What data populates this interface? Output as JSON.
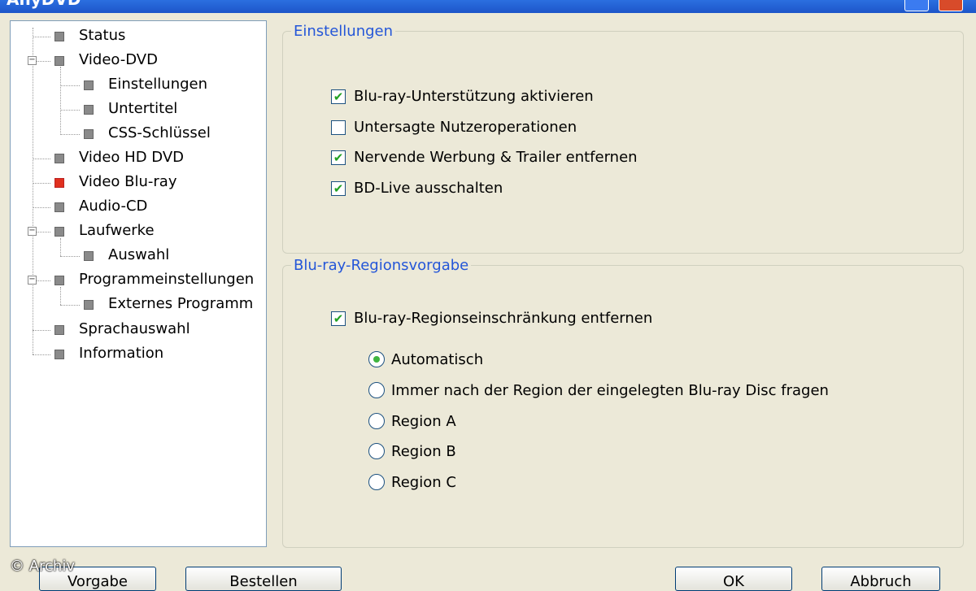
{
  "window": {
    "title": "AnyDVD"
  },
  "tree": {
    "items": [
      {
        "label": "Status"
      },
      {
        "label": "Video-DVD"
      },
      {
        "label": "Einstellungen"
      },
      {
        "label": "Untertitel"
      },
      {
        "label": "CSS-Schlüssel"
      },
      {
        "label": "Video HD DVD"
      },
      {
        "label": "Video Blu-ray"
      },
      {
        "label": "Audio-CD"
      },
      {
        "label": "Laufwerke"
      },
      {
        "label": "Auswahl"
      },
      {
        "label": "Programmeinstellungen"
      },
      {
        "label": "Externes Programm"
      },
      {
        "label": "Sprachauswahl"
      },
      {
        "label": "Information"
      }
    ],
    "selected": "Video Blu-ray",
    "selected_color": "#e0301e"
  },
  "settings": {
    "title": "Einstellungen",
    "options": [
      {
        "label": "Blu-ray-Unterstützung aktivieren",
        "checked": true
      },
      {
        "label": "Untersagte Nutzeroperationen",
        "checked": false
      },
      {
        "label": "Nervende Werbung & Trailer entfernen",
        "checked": true
      },
      {
        "label": "BD-Live ausschalten",
        "checked": true
      }
    ]
  },
  "region": {
    "title": "Blu-ray-Regionsvorgabe",
    "remove": {
      "label": "Blu-ray-Regionseinschränkung entfernen",
      "checked": true
    },
    "choices": [
      {
        "label": "Automatisch",
        "selected": true
      },
      {
        "label": "Immer nach der Region der eingelegten Blu-ray Disc fragen",
        "selected": false
      },
      {
        "label": "Region A",
        "selected": false
      },
      {
        "label": "Region B",
        "selected": false
      },
      {
        "label": "Region C",
        "selected": false
      }
    ]
  },
  "buttons": {
    "default": "Vorgabe",
    "order": "Bestellen",
    "ok": "OK",
    "cancel": "Abbruch"
  },
  "watermark": "© Archiv",
  "check_glyph": "✔"
}
